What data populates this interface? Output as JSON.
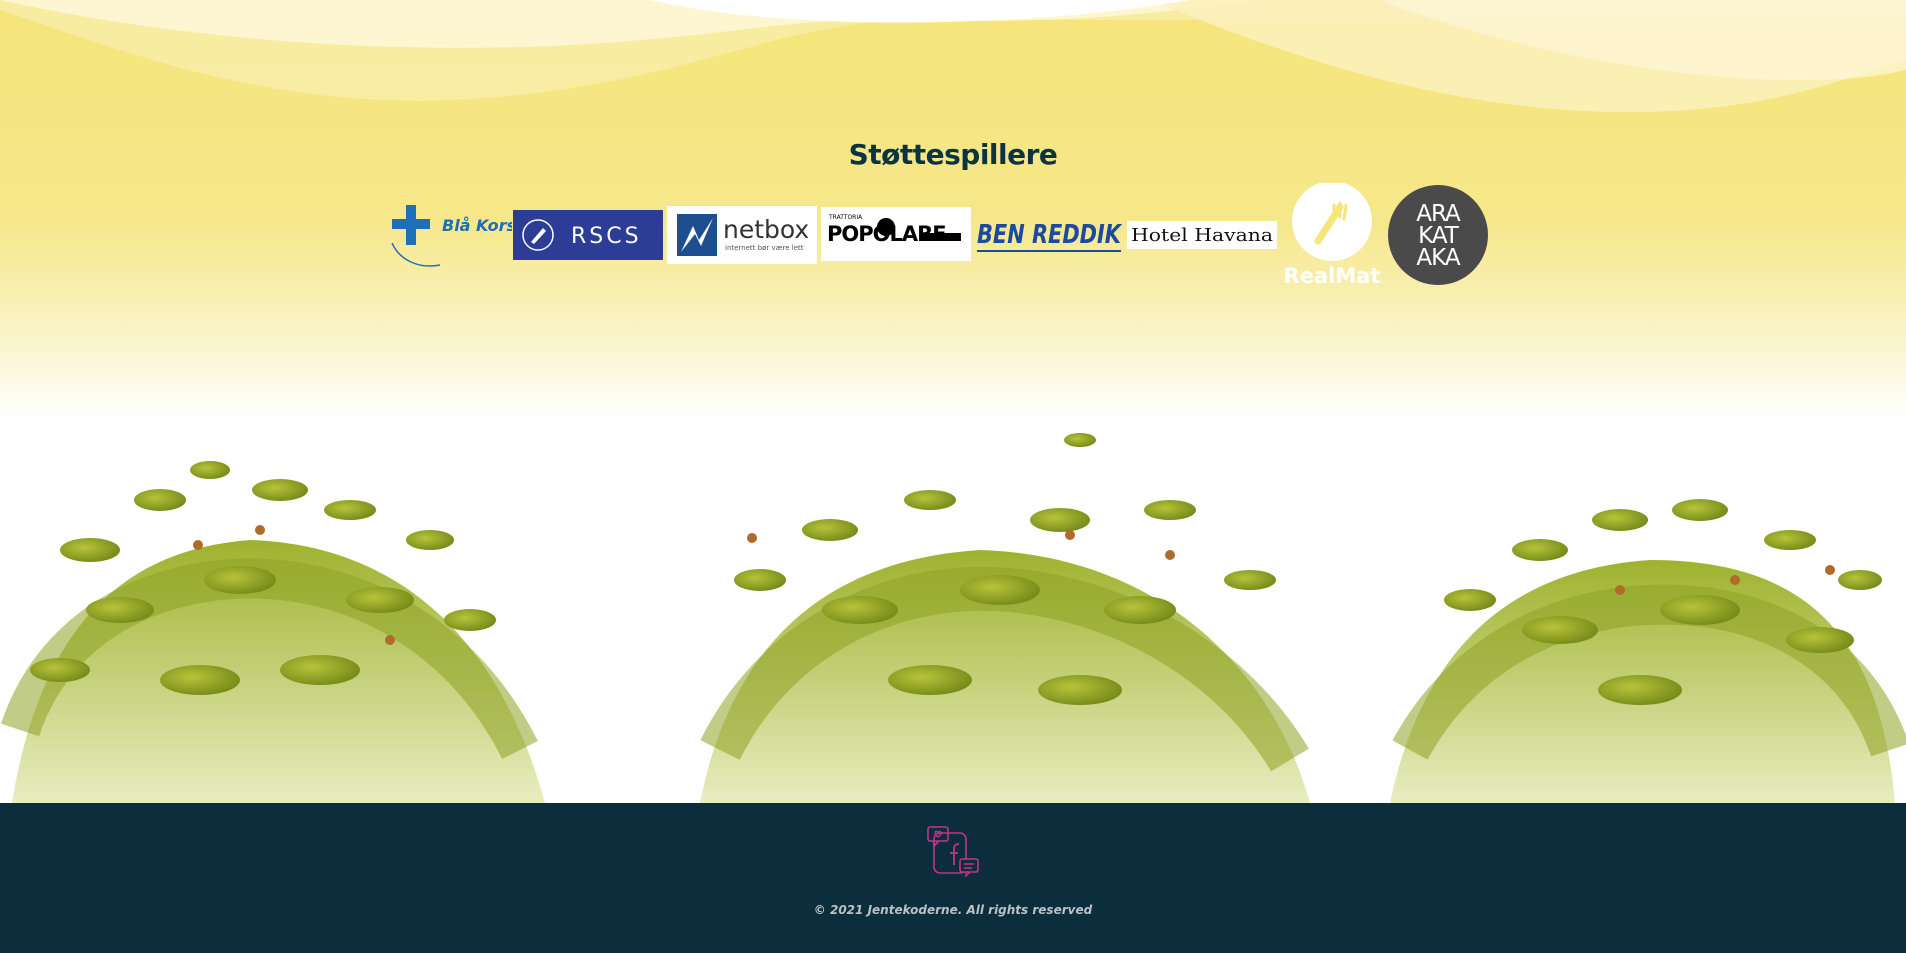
{
  "sponsors": {
    "title": "Støttespillere",
    "logos": [
      {
        "name": "Blå Kors",
        "text": "Blå Kors",
        "color": "#1d6fb7"
      },
      {
        "name": "RSCS",
        "text": "RSCS",
        "color": "#2d3c96"
      },
      {
        "name": "netbox",
        "text": "netbox",
        "tagline": "internett bør være lett",
        "color": "#1d4f8f"
      },
      {
        "name": "Trattoria Popolare",
        "text": "POPOLARE",
        "tagline": "TRATTORIA",
        "color": "#000000"
      },
      {
        "name": "Ben Reddik",
        "text": "BEN REDDIK",
        "color": "#1c4aa0"
      },
      {
        "name": "Hotel Havana",
        "text": "Hotel Havana",
        "color": "#111111"
      },
      {
        "name": "RealMat",
        "text": "RealMat",
        "color": "#ffffff"
      },
      {
        "name": "Arakataka",
        "lines": [
          "ARA",
          "KAT",
          "AKA"
        ],
        "color": "#4a4a4a"
      }
    ]
  },
  "footer": {
    "social_icon": "facebook-icon",
    "copyright_prefix": "© 2021 ",
    "copyright_brand": "Jentekoderne",
    "copyright_suffix": ". All rights reserved"
  },
  "colors": {
    "accent_yellow": "#f5e57a",
    "dark_teal": "#0b2d3c",
    "title_color": "#0b3443",
    "icon_pink": "#c2348a"
  }
}
